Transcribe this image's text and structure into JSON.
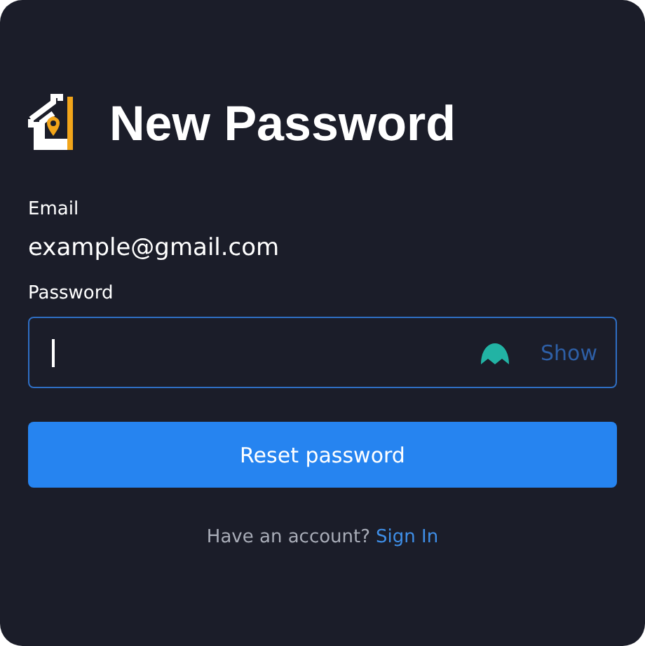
{
  "title": "New Password",
  "email": {
    "label": "Email",
    "value": "example@gmail.com"
  },
  "password": {
    "label": "Password",
    "toggle": "Show"
  },
  "submit": "Reset password",
  "footer": {
    "text": "Have an account?",
    "link": "Sign In"
  }
}
